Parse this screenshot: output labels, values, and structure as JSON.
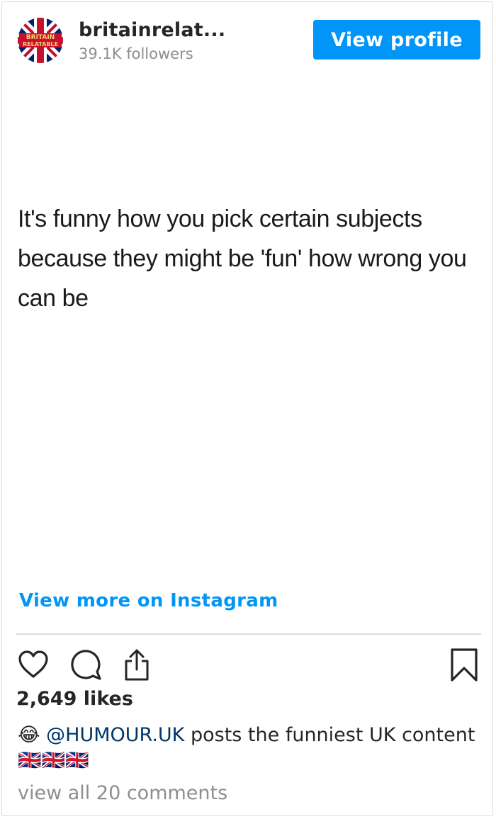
{
  "header": {
    "username": "britainrelat...",
    "followers": "39.1K followers",
    "view_profile_label": "View profile",
    "avatar_text_top": "BRITAIN",
    "avatar_text_bottom": "RELATABLE"
  },
  "post": {
    "text": "It's funny how you pick certain subjects because they might be 'fun' how wrong you can be"
  },
  "view_more_label": "View more on Instagram",
  "likes": "2,649 likes",
  "caption": {
    "emoji": "😂",
    "mention": "@HUMOUR.UK",
    "text": " posts the funniest UK content 🇬🇧🇬🇧🇬🇧"
  },
  "comments_link": "view all 20 comments",
  "icons": [
    "heart-icon",
    "comment-icon",
    "share-icon",
    "bookmark-icon"
  ],
  "colors": {
    "accent": "#0095f6",
    "text": "#262626",
    "muted": "#8e8e8e",
    "mention": "#00376b",
    "flag_blue": "#012169",
    "flag_red": "#C8102E"
  }
}
